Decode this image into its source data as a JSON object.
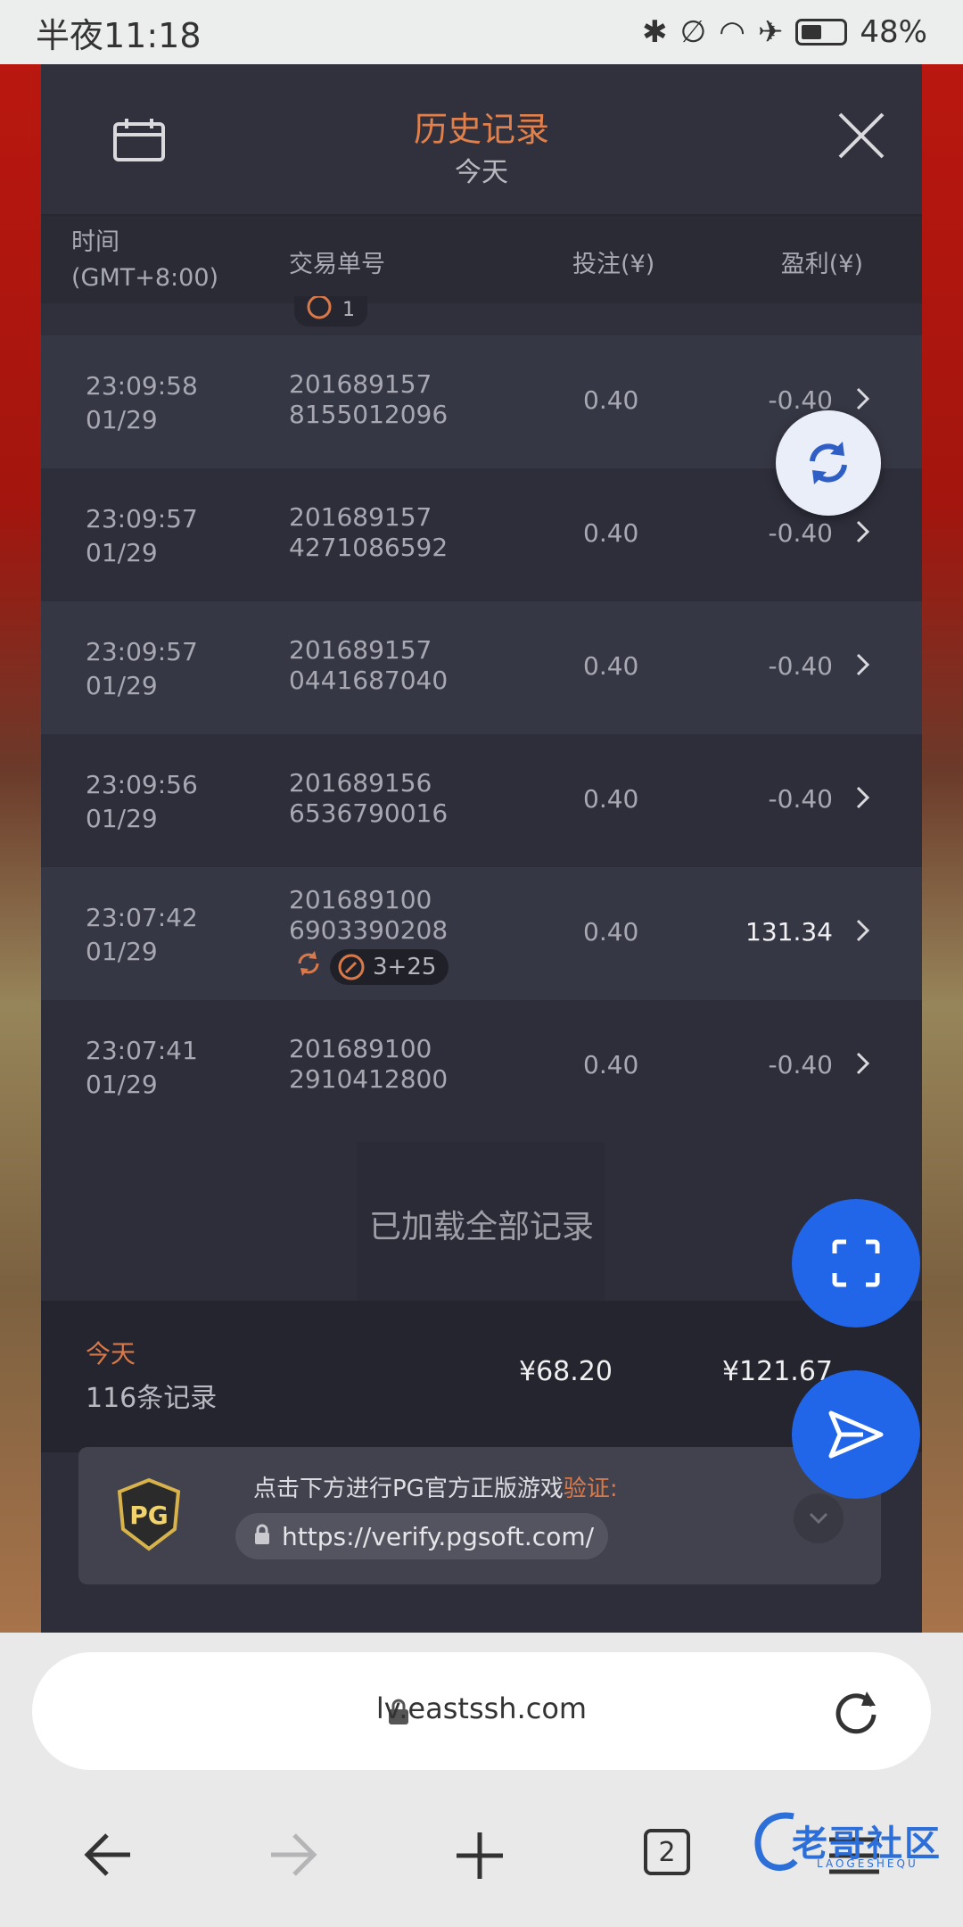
{
  "status_bar": {
    "time": "半夜11:18",
    "battery": "48%",
    "battery_level": 0.48
  },
  "history": {
    "title": "历史记录",
    "subtitle": "今天",
    "columns": {
      "time_line1": "时间",
      "time_line2": "(GMT+8:00)",
      "txn": "交易单号",
      "bet": "投注(¥)",
      "profit": "盈利(¥)"
    },
    "rows": [
      {
        "time": "23:09:58",
        "date": "01/29",
        "id1": "201689157",
        "id2": "8155012096",
        "bet": "0.40",
        "profit": "-0.40"
      },
      {
        "time": "23:09:57",
        "date": "01/29",
        "id1": "201689157",
        "id2": "4271086592",
        "bet": "0.40",
        "profit": "-0.40"
      },
      {
        "time": "23:09:57",
        "date": "01/29",
        "id1": "201689157",
        "id2": "0441687040",
        "bet": "0.40",
        "profit": "-0.40"
      },
      {
        "time": "23:09:56",
        "date": "01/29",
        "id1": "201689156",
        "id2": "6536790016",
        "bet": "0.40",
        "profit": "-0.40"
      },
      {
        "time": "23:07:42",
        "date": "01/29",
        "id1": "201689100",
        "id2": "6903390208",
        "bet": "0.40",
        "profit": "131.34",
        "tag": "3+25"
      },
      {
        "time": "23:07:41",
        "date": "01/29",
        "id1": "201689100",
        "id2": "2910412800",
        "bet": "0.40",
        "profit": "-0.40"
      }
    ],
    "stub_tag": "1",
    "loaded_all": "已加载全部记录",
    "summary": {
      "label": "今天",
      "count": "116条记录",
      "bet_total": "¥68.20",
      "profit_total": "¥121.67"
    }
  },
  "verify": {
    "message": "点击下方进行PG官方正版游戏",
    "message_highlight": "验证:",
    "logo_text": "PG",
    "url": "https://verify.pgsoft.com/"
  },
  "browser": {
    "host": "lv.eastssh.com",
    "tab_count": "2"
  },
  "watermark": {
    "text": "老哥社区",
    "sub": "LAOGESHEQU"
  },
  "colors": {
    "accent": "#e1804b",
    "fab": "#2166e9",
    "panel": "#2d2e3a"
  }
}
